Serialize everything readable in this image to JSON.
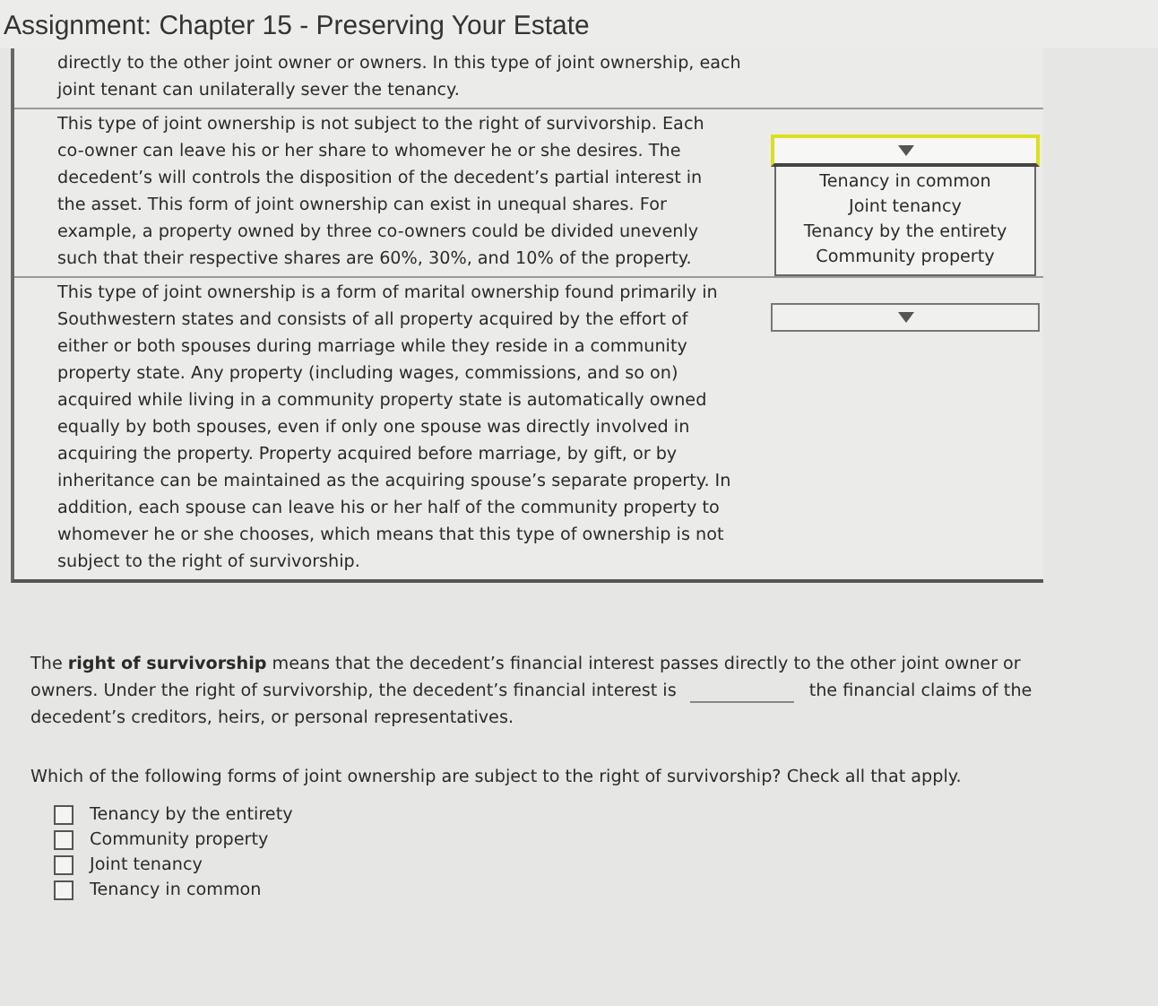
{
  "title": "Assignment: Chapter 15 - Preserving Your Estate",
  "matching_rows": [
    {
      "text": "directly to the other joint owner or owners. In this type of joint ownership, each joint tenant can unilaterally sever the tenancy."
    },
    {
      "text": "This type of joint ownership is not subject to the right of survivorship. Each co-owner can leave his or her share to whomever he or she desires. The decedent’s will controls the disposition of the decedent’s partial interest in the asset. This form of joint ownership can exist in unequal shares. For example, a property owned by three co-owners could be divided unevenly such that their respective shares are 60%, 30%, and 10% of the property.",
      "dropdown": {
        "focused": true,
        "expanded": true,
        "options": [
          "Tenancy in common",
          "Joint tenancy",
          "Tenancy by the entirety",
          "Community property"
        ]
      }
    },
    {
      "text": "This type of joint ownership is a form of marital ownership found primarily in Southwestern states and consists of all property acquired by the effort of either or both spouses during marriage while they reside in a community property state. Any property (including wages, commissions, and so on) acquired while living in a community property state is automatically owned equally by both spouses, even if only one spouse was directly involved in acquiring the property. Property acquired before marriage, by gift, or by inheritance can be maintained as the acquiring spouse’s separate property. In addition, each spouse can leave his or her half of the community property to whomever he or she chooses, which means that this type of ownership is not subject to the right of survivorship.",
      "dropdown": {
        "focused": false,
        "expanded": false
      }
    }
  ],
  "fill_in": {
    "first_line": "The **right of survivorship** means that the decedent’s financial interest passes directly to the other joint owner or",
    "before_blank": "owners. Under the right of survivorship, the decedent’s financial interest is",
    "after_blank": "the financial claims of the",
    "last_line": "decedent’s creditors, heirs, or personal representatives."
  },
  "question": "Which of the following forms of joint ownership are subject to the right of survivorship? Check all that apply.",
  "choices": [
    {
      "label": "Tenancy by the entirety",
      "checked": false
    },
    {
      "label": "Community property",
      "checked": false
    },
    {
      "label": "Joint tenancy",
      "checked": false
    },
    {
      "label": "Tenancy in common",
      "checked": false
    }
  ]
}
